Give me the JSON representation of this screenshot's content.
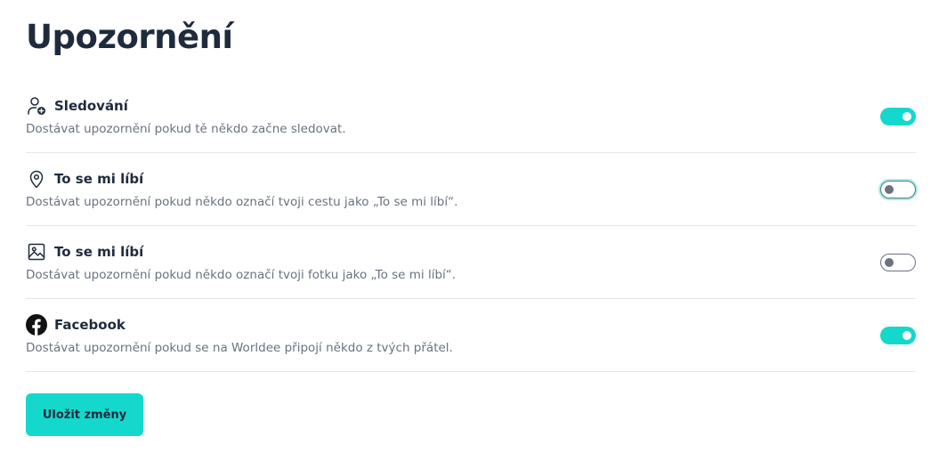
{
  "page": {
    "title": "Upozornění"
  },
  "settings": [
    {
      "icon": "user-plus-icon",
      "title": "Sledování",
      "description": "Dostávat upozornění pokud tě někdo začne sledovat.",
      "enabled": true
    },
    {
      "icon": "map-pin-icon",
      "title": "To se mi líbí",
      "description": "Dostávat upozornění pokud někdo označí tvoji cestu jako „To se mi líbí“.",
      "enabled": false
    },
    {
      "icon": "image-icon",
      "title": "To se mi líbí",
      "description": "Dostávat upozornění pokud někdo označí tvoji fotku jako „To se mi líbí“.",
      "enabled": false
    },
    {
      "icon": "facebook-icon",
      "title": "Facebook",
      "description": "Dostávat upozornění pokud se na Worldee připojí někdo z tvých přátel.",
      "enabled": true
    }
  ],
  "actions": {
    "save_label": "Uložit změny"
  },
  "colors": {
    "accent": "#15d8cc",
    "text": "#1f2b3d",
    "muted": "#6a7281"
  }
}
